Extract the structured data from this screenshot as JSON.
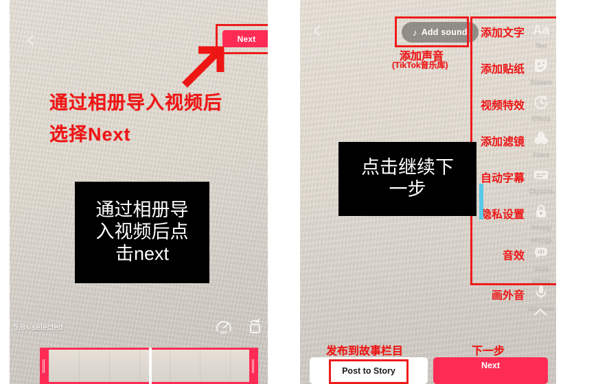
{
  "meta": {
    "accent_pink": "#fe2c55",
    "annotation_red": "#ee1515",
    "panel_bg": "#e4ded4"
  },
  "left_panel": {
    "back_icon": "chevron-left-icon",
    "next_button": "Next",
    "annotation_line1": "通过相册导入视频后",
    "annotation_line2": "选择Next",
    "arrow_icon": "arrow-up-right-icon",
    "black_note": "通过相册导\n入视频后点\n击next",
    "selection_label": "5.8s selected",
    "speed_icon": "speed-off-icon",
    "rotate_icon": "rotate-icon"
  },
  "right_panel": {
    "back_icon": "chevron-left-icon",
    "add_sound_button": "Add sound",
    "add_sound_icon": "music-note-icon",
    "add_sound_annotation_line1": "添加声音",
    "add_sound_annotation_line2": "(TikTok音乐库)",
    "black_note": "点击继续下\n一步",
    "sidebar": [
      {
        "cn": "添加文字",
        "en": "Text",
        "icon": "text-aa-icon"
      },
      {
        "cn": "添加贴纸",
        "en": "Stickers",
        "icon": "sticker-icon"
      },
      {
        "cn": "视频特效",
        "en": "Effects",
        "icon": "effects-clock-icon"
      },
      {
        "cn": "添加滤镜",
        "en": "Filters",
        "icon": "filters-circles-icon"
      },
      {
        "cn": "自动字幕",
        "en": "Captions",
        "icon": "captions-icon"
      },
      {
        "cn": "隐私设置",
        "en": "Privacy\nsettings",
        "icon": "lock-icon"
      },
      {
        "cn": "音效",
        "en": "Voice\neffects",
        "icon": "voice-effects-icon"
      },
      {
        "cn": "画外音",
        "en": "Voiceover",
        "icon": "microphone-icon"
      }
    ],
    "collapse_icon": "chevron-up-icon",
    "post_story_annotation": "发布到故事栏目",
    "post_story_button": "Post to Story",
    "next_annotation": "下一步",
    "next_button": "Next"
  }
}
